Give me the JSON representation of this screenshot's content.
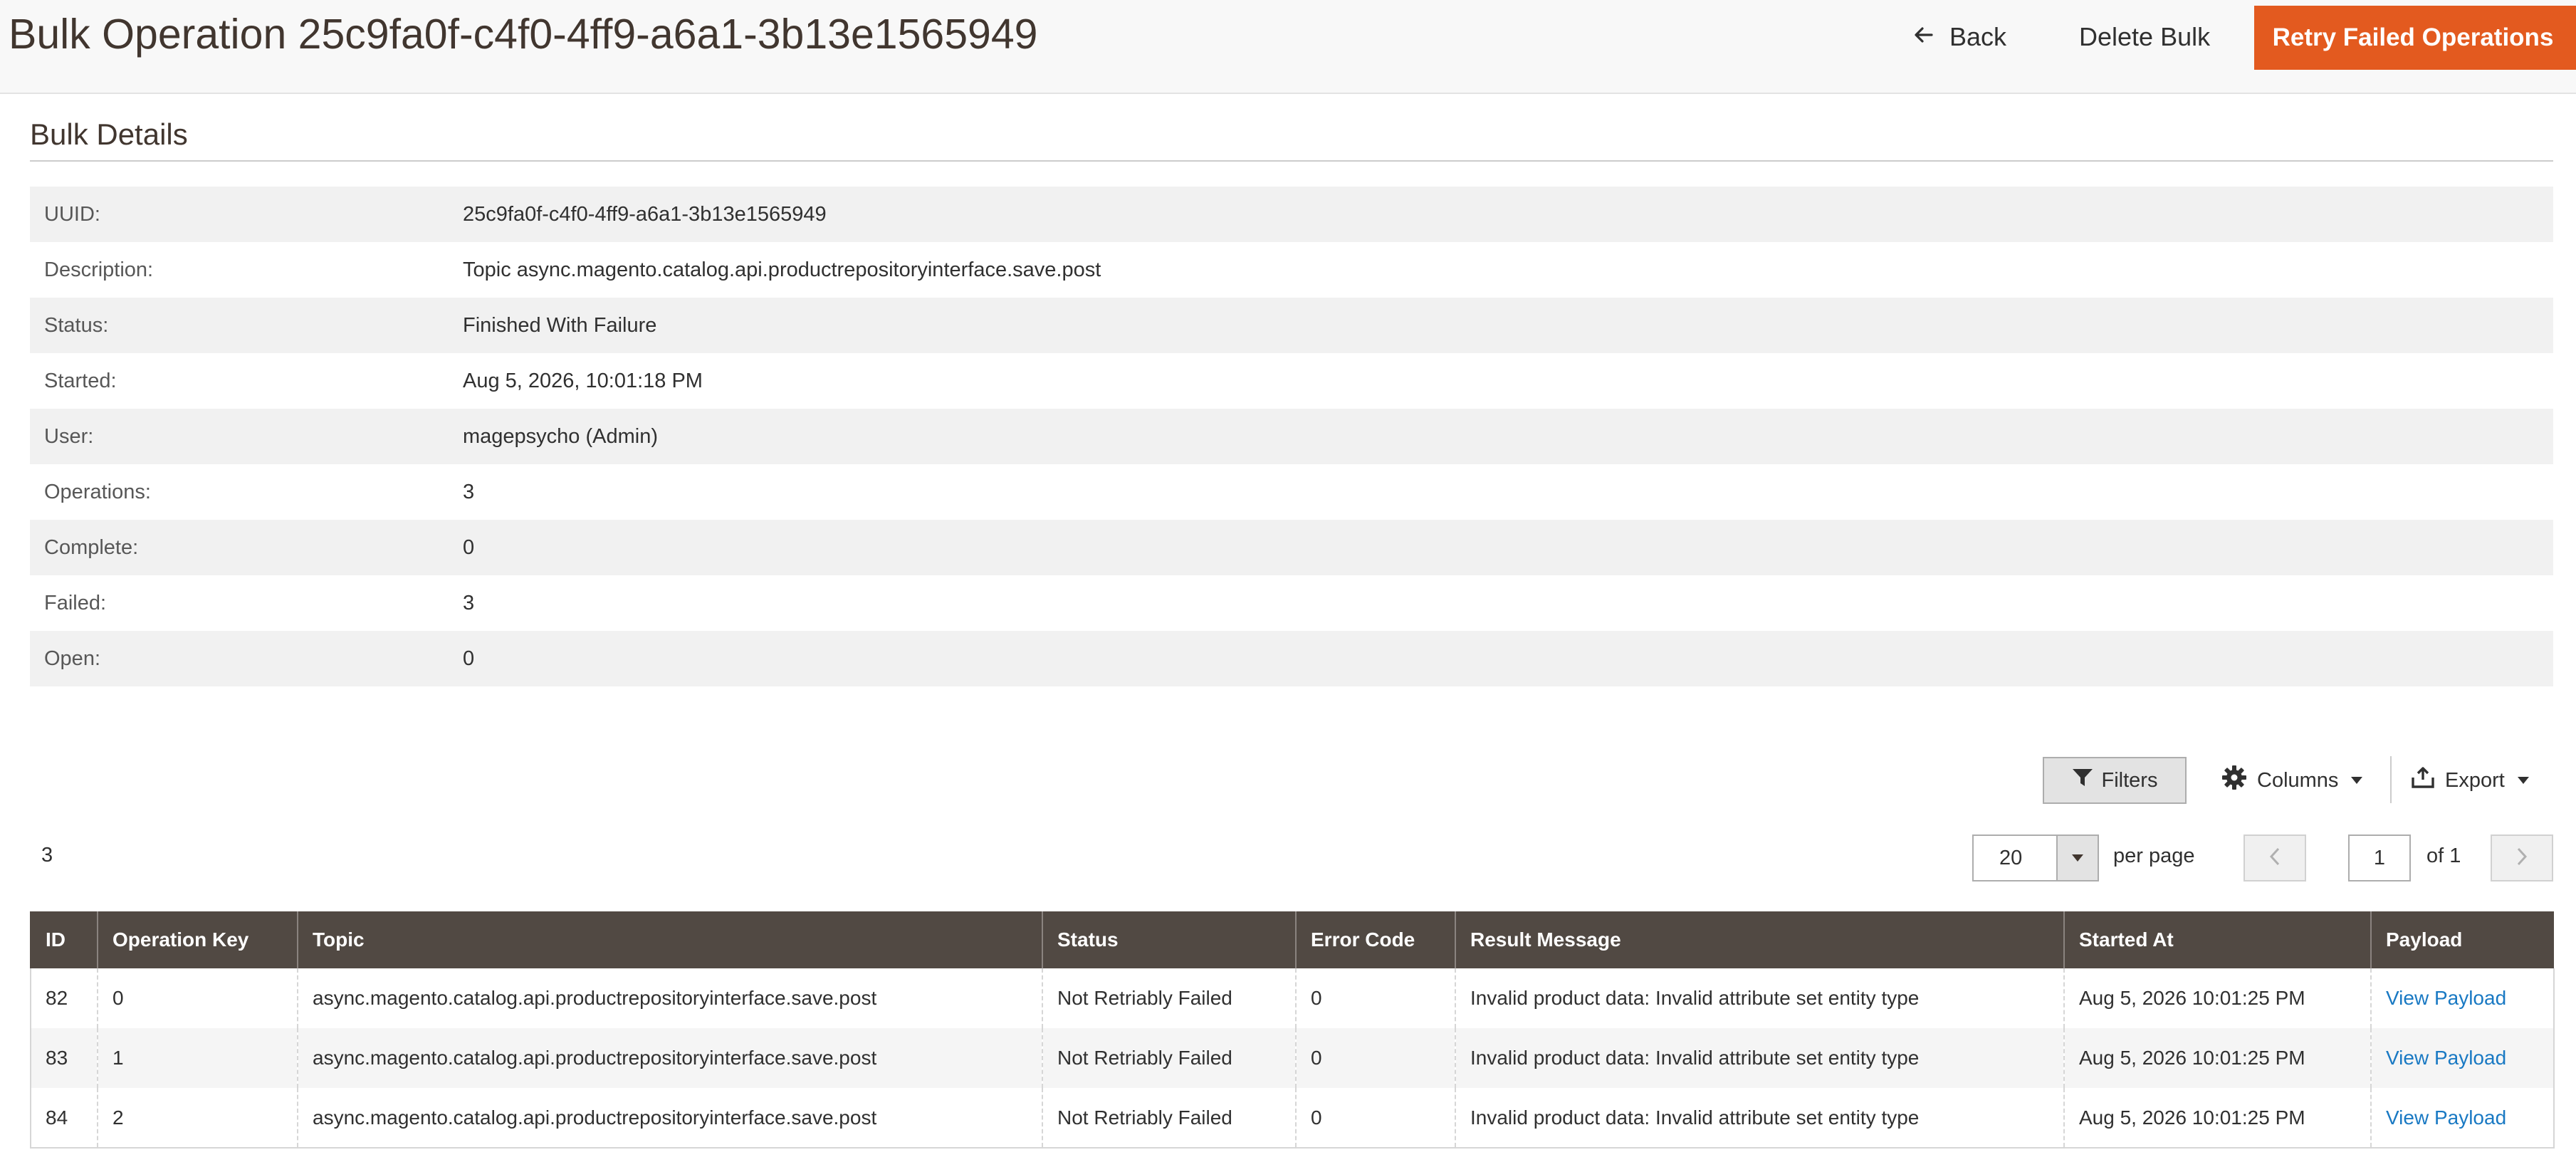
{
  "header": {
    "title": "Bulk Operation 25c9fa0f-c4f0-4ff9-a6a1-3b13e1565949",
    "back_label": "Back",
    "delete_label": "Delete Bulk",
    "retry_label": "Retry Failed Operations",
    "retry_color": "#e35a1f"
  },
  "details": {
    "section_title": "Bulk Details",
    "rows": [
      {
        "label": "UUID:",
        "value": "25c9fa0f-c4f0-4ff9-a6a1-3b13e1565949"
      },
      {
        "label": "Description:",
        "value": "Topic async.magento.catalog.api.productrepositoryinterface.save.post"
      },
      {
        "label": "Status:",
        "value": "Finished With Failure"
      },
      {
        "label": "Started:",
        "value": "Aug 5, 2026, 10:01:18 PM"
      },
      {
        "label": "User:",
        "value": "magepsycho (Admin)"
      },
      {
        "label": "Operations:",
        "value": "3"
      },
      {
        "label": "Complete:",
        "value": "0"
      },
      {
        "label": "Failed:",
        "value": "3"
      },
      {
        "label": "Open:",
        "value": "0"
      }
    ]
  },
  "toolbar": {
    "filters_label": "Filters",
    "columns_label": "Columns",
    "export_label": "Export",
    "record_count": "3",
    "per_page_value": "20",
    "per_page_label": "per page",
    "current_page": "1",
    "page_of_label": "of 1"
  },
  "grid": {
    "header_color": "#514943",
    "columns": [
      "ID",
      "Operation Key",
      "Topic",
      "Status",
      "Error Code",
      "Result Message",
      "Started At",
      "Payload"
    ],
    "rows": [
      {
        "id": "82",
        "operation_key": "0",
        "topic": "async.magento.catalog.api.productrepositoryinterface.save.post",
        "status": "Not Retriably Failed",
        "error_code": "0",
        "result_message": "Invalid product data: Invalid attribute set entity type",
        "started_at": "Aug 5, 2026 10:01:25 PM",
        "payload": "View Payload"
      },
      {
        "id": "83",
        "operation_key": "1",
        "topic": "async.magento.catalog.api.productrepositoryinterface.save.post",
        "status": "Not Retriably Failed",
        "error_code": "0",
        "result_message": "Invalid product data: Invalid attribute set entity type",
        "started_at": "Aug 5, 2026 10:01:25 PM",
        "payload": "View Payload"
      },
      {
        "id": "84",
        "operation_key": "2",
        "topic": "async.magento.catalog.api.productrepositoryinterface.save.post",
        "status": "Not Retriably Failed",
        "error_code": "0",
        "result_message": "Invalid product data: Invalid attribute set entity type",
        "started_at": "Aug 5, 2026 10:01:25 PM",
        "payload": "View Payload"
      }
    ]
  },
  "icons": {
    "back": "arrow-left-icon",
    "filter": "filter-icon",
    "columns": "gear-icon",
    "export": "export-icon",
    "prev": "chevron-left-icon",
    "next": "chevron-right-icon"
  }
}
